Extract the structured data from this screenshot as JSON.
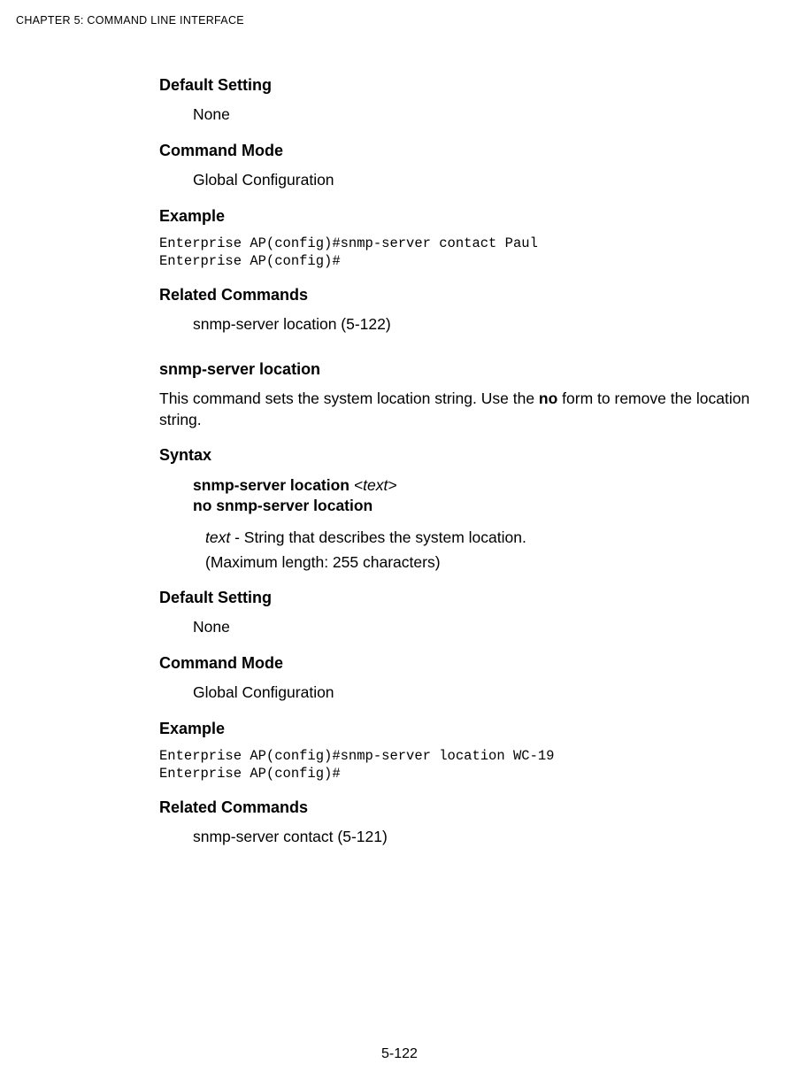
{
  "header": {
    "chapter_c": "C",
    "chapter_rest": "HAPTER",
    "num": " 5: ",
    "title_c": "C",
    "title_rest1": "OMMAND",
    "title_l": " L",
    "title_rest2": "INE",
    "title_i": " I",
    "title_rest3": "NTERFACE"
  },
  "s1": {
    "default_setting_h": "Default Setting",
    "default_setting_v": "None",
    "command_mode_h": "Command Mode",
    "command_mode_v": "Global Configuration",
    "example_h": "Example",
    "example_code": "Enterprise AP(config)#snmp-server contact Paul\nEnterprise AP(config)#",
    "related_h": "Related Commands",
    "related_v": "snmp-server location (5-122)"
  },
  "s2": {
    "title": "snmp-server location",
    "desc_pre": "This command sets the system location string. Use the ",
    "desc_bold": "no",
    "desc_post": " form to remove the location string.",
    "syntax_h": "Syntax",
    "syntax_l1_bold": "snmp-server location ",
    "syntax_l1_var": "<text>",
    "syntax_l2_bold": "no snmp-server location",
    "arg_italic": "text",
    "arg_rest": " - String that describes the system location.",
    "arg_line2": "(Maximum length: 255 characters)",
    "default_setting_h": "Default Setting",
    "default_setting_v": "None",
    "command_mode_h": "Command Mode",
    "command_mode_v": "Global Configuration",
    "example_h": "Example",
    "example_code": "Enterprise AP(config)#snmp-server location WC-19\nEnterprise AP(config)#",
    "related_h": "Related Commands",
    "related_v": "snmp-server contact (5-121)"
  },
  "page_number": "5-122"
}
